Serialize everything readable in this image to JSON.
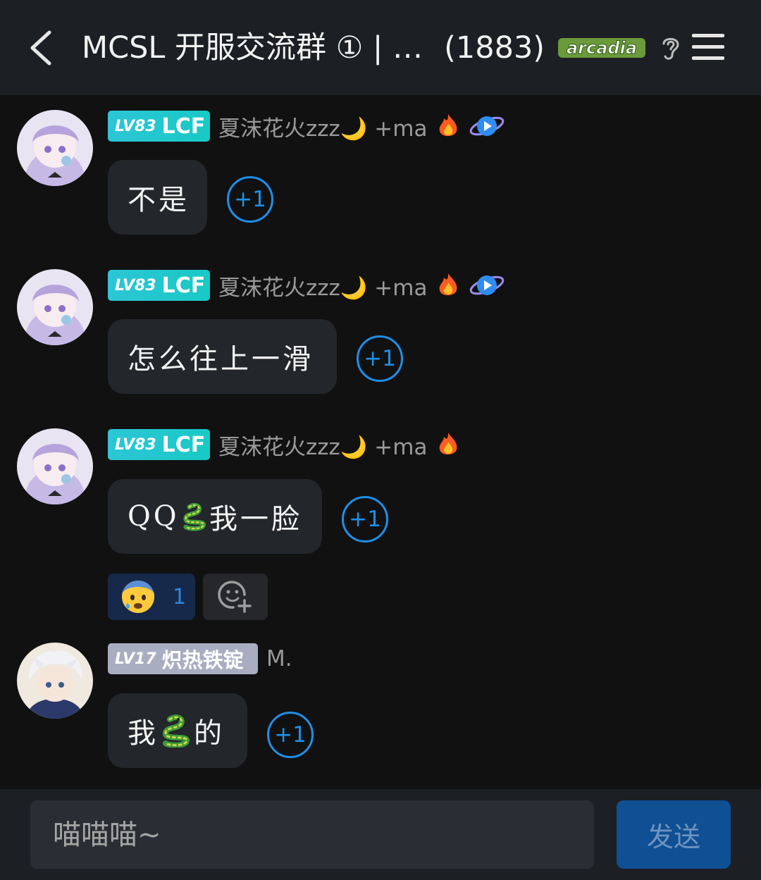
{
  "header": {
    "title": "MCSL 开服交流群 ① | …",
    "member_count": "(1883)",
    "brand_logo_text": "arcadia"
  },
  "messages": [
    {
      "level": "LV83",
      "badge_title": "LCF",
      "sender": "夏沫花火zzz🌙 +ma",
      "text": "不是",
      "plus_label": "+1"
    },
    {
      "level": "LV83",
      "badge_title": "LCF",
      "sender": "夏沫花火zzz🌙 +ma",
      "text": "怎么往上一滑",
      "plus_label": "+1"
    },
    {
      "level": "LV83",
      "badge_title": "LCF",
      "sender": "夏沫花火zzz🌙 +ma",
      "text_before": "QQ",
      "text_after": "我一脸",
      "plus_label": "+1",
      "reaction": {
        "emoji": "anxious-face-with-sweat",
        "count": "1"
      }
    },
    {
      "level": "LV17",
      "badge_title": "炽热铁锭",
      "sender": "M.",
      "text_before": "我",
      "text_after": "的",
      "plus_label": "+1"
    }
  ],
  "composer": {
    "placeholder": "喵喵喵~",
    "send_label": "发送"
  },
  "colors": {
    "background": "#111111",
    "header": "#1c1f24",
    "bubble": "#23262b",
    "accent_blue": "#1e8fe8",
    "badge_teal": "#1fc7cf",
    "badge_gray": "#a9adc2"
  }
}
